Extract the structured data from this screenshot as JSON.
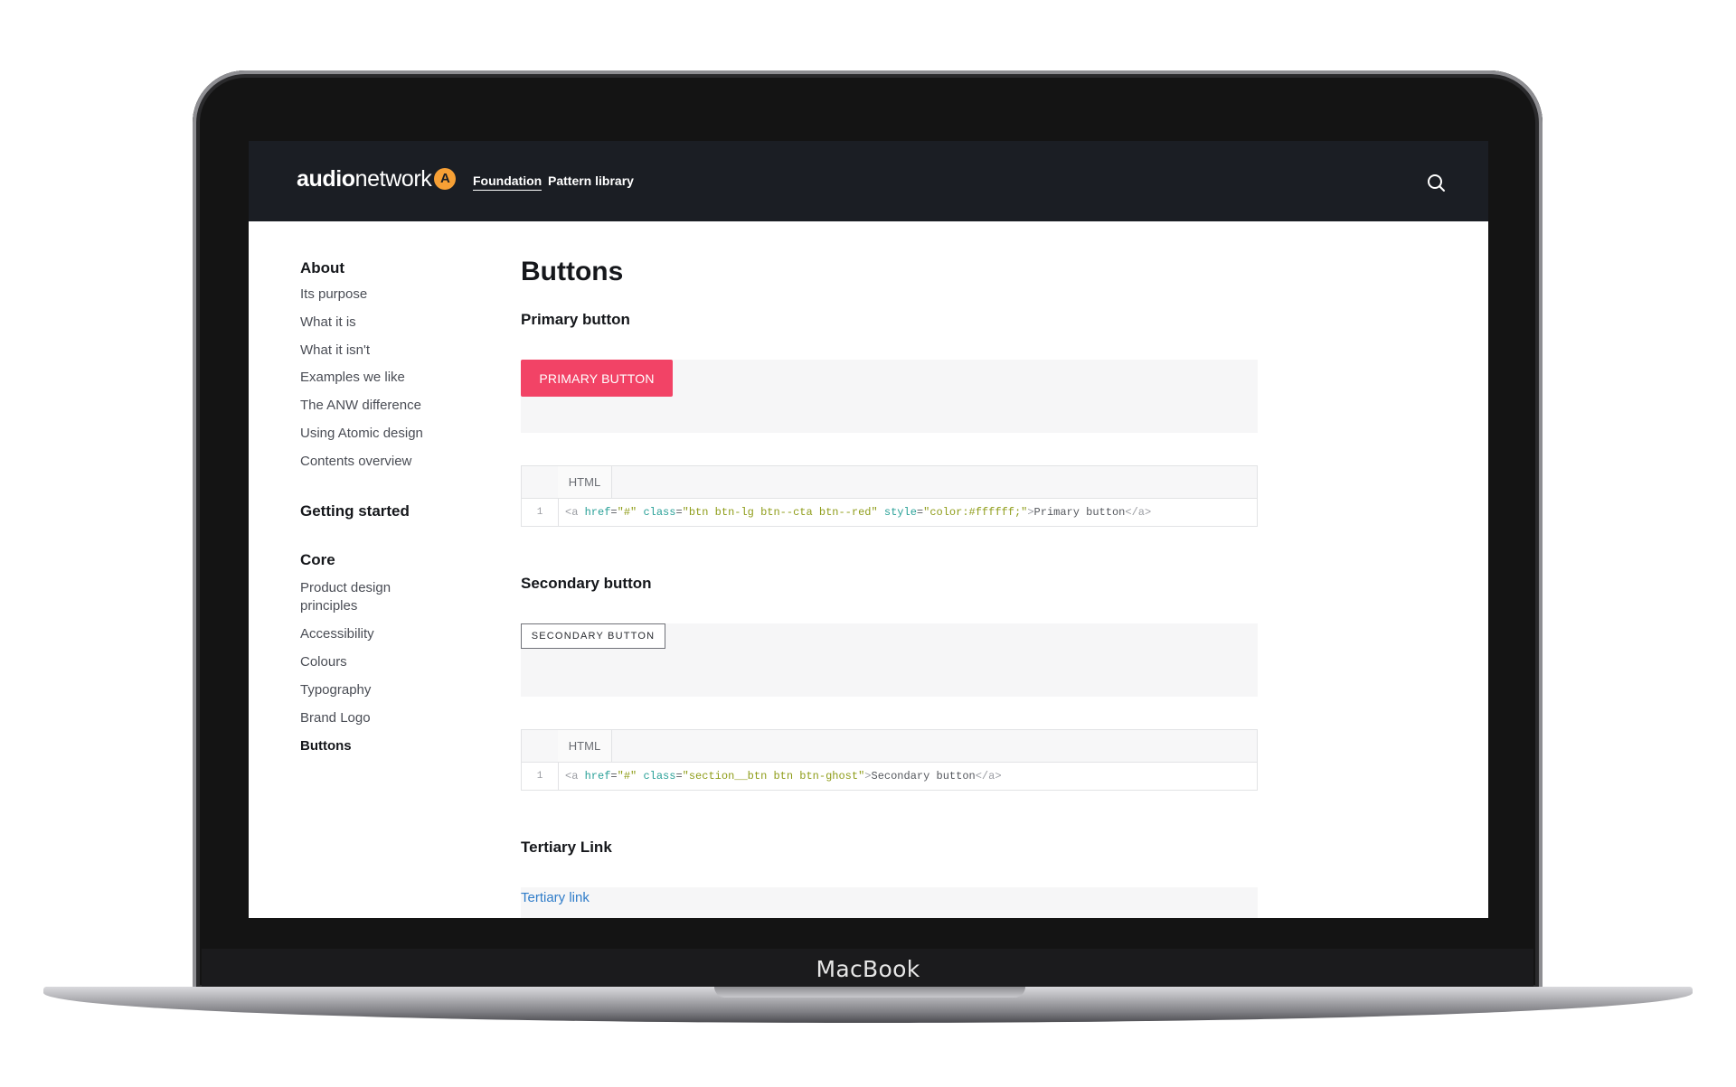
{
  "device": {
    "label": "MacBook"
  },
  "header": {
    "logo": {
      "part1": "audio",
      "part2": "network",
      "mark": "A"
    },
    "nav": [
      {
        "label": "Foundation",
        "active": true
      },
      {
        "label": "Pattern library",
        "active": false
      }
    ],
    "search_icon": "search-icon"
  },
  "sidebar": {
    "sections": [
      {
        "heading": "About",
        "items": [
          "Its purpose",
          "What it is",
          "What it isn't",
          "Examples we like",
          "The ANW difference",
          "Using Atomic design",
          "Contents overview"
        ]
      },
      {
        "heading": "Getting started",
        "items": []
      },
      {
        "heading": "Core",
        "items": [
          "Product design principles",
          "Accessibility",
          "Colours",
          "Typography",
          "Brand Logo",
          "Buttons"
        ]
      }
    ],
    "current": "Buttons"
  },
  "main": {
    "title": "Buttons",
    "primary": {
      "heading": "Primary button",
      "button_label": "PRIMARY BUTTON",
      "code_tab": "HTML",
      "line_number": "1",
      "code": [
        {
          "t": "tag",
          "v": "<a "
        },
        {
          "t": "attr",
          "v": "href"
        },
        {
          "t": "text",
          "v": "="
        },
        {
          "t": "val",
          "v": "\"#\" "
        },
        {
          "t": "attr",
          "v": "class"
        },
        {
          "t": "text",
          "v": "="
        },
        {
          "t": "val",
          "v": "\"btn btn-lg btn--cta btn--red\" "
        },
        {
          "t": "attr",
          "v": "style"
        },
        {
          "t": "text",
          "v": "="
        },
        {
          "t": "val",
          "v": "\"color:#ffffff;\""
        },
        {
          "t": "tag",
          "v": ">"
        },
        {
          "t": "text",
          "v": "Primary button"
        },
        {
          "t": "tag",
          "v": "</a>"
        }
      ]
    },
    "secondary": {
      "heading": "Secondary button",
      "button_label": "SECONDARY BUTTON",
      "code_tab": "HTML",
      "line_number": "1",
      "code": [
        {
          "t": "tag",
          "v": "<a "
        },
        {
          "t": "attr",
          "v": "href"
        },
        {
          "t": "text",
          "v": "="
        },
        {
          "t": "val",
          "v": "\"#\" "
        },
        {
          "t": "attr",
          "v": "class"
        },
        {
          "t": "text",
          "v": "="
        },
        {
          "t": "val",
          "v": "\"section__btn btn btn-ghost\""
        },
        {
          "t": "tag",
          "v": ">"
        },
        {
          "t": "text",
          "v": "Secondary button"
        },
        {
          "t": "tag",
          "v": "</a>"
        }
      ]
    },
    "tertiary": {
      "heading": "Tertiary Link",
      "link_label": "Tertiary link"
    }
  },
  "colors": {
    "header_bg": "#1b1e24",
    "primary_button": "#f24366",
    "logo_accent": "#f7a035",
    "link": "#2f7cc9"
  }
}
